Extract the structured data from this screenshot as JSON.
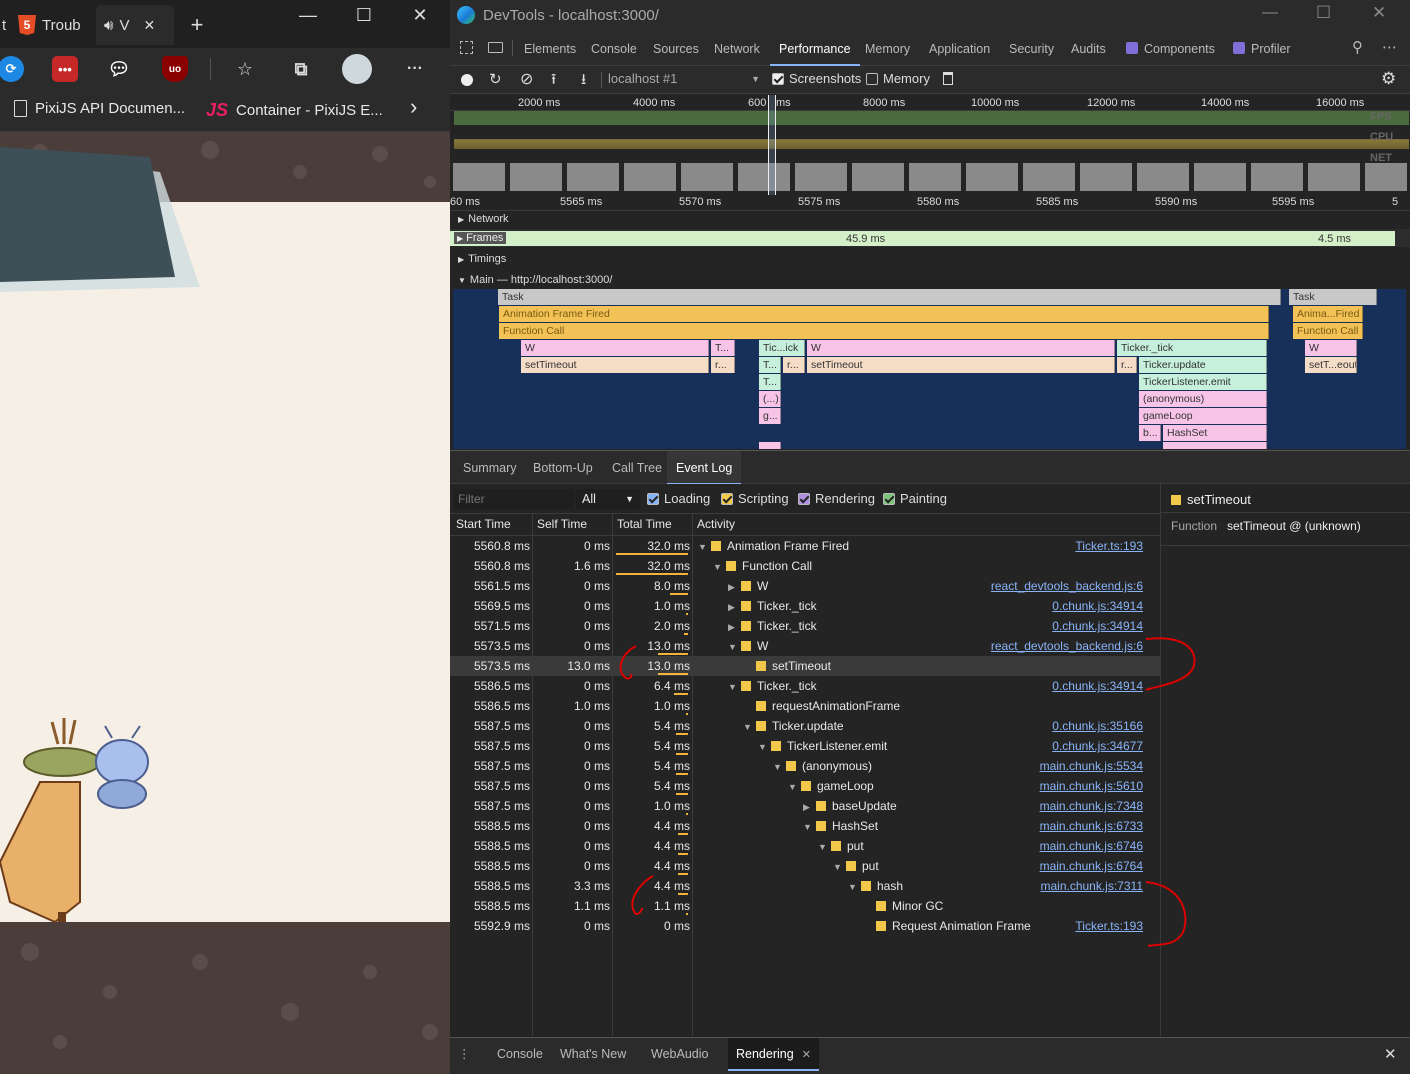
{
  "browser": {
    "tabs": [
      {
        "label": "t"
      },
      {
        "label": "Troub"
      },
      {
        "label": "V"
      }
    ],
    "new_tab": "+",
    "window_controls": {
      "minimize": "—",
      "maximize": "☐",
      "close": "✕"
    },
    "more_label": "···",
    "favorites": [
      {
        "label": "PixiJS API Documen..."
      },
      {
        "label": "Container - PixiJS E..."
      }
    ],
    "fav_more": "›"
  },
  "devtools": {
    "title": "DevTools - localhost:3000/",
    "panel_tabs": [
      "Elements",
      "Console",
      "Sources",
      "Network",
      "Performance",
      "Memory",
      "Application",
      "Security",
      "Audits",
      "Components",
      "Profiler"
    ],
    "active_tab": "Performance",
    "toolbar": {
      "target": "localhost #1",
      "screenshots_label": "Screenshots",
      "screenshots_checked": true,
      "memory_label": "Memory",
      "memory_checked": false
    },
    "overview_ticks": [
      "2000 ms",
      "4000 ms",
      "600",
      "ms",
      "8000 ms",
      "10000 ms",
      "12000 ms",
      "14000 ms",
      "16000 ms"
    ],
    "overview_labels": {
      "fps": "FPS",
      "cpu": "CPU",
      "net": "NET"
    },
    "ruler_ticks": [
      "60 ms",
      "5565 ms",
      "5570 ms",
      "5575 ms",
      "5580 ms",
      "5585 ms",
      "5590 ms",
      "5595 ms",
      "5"
    ],
    "tracks": {
      "network": "Network",
      "frames": "Frames",
      "frame_1": "45.9 ms",
      "frame_2": "4.5 ms",
      "timings": "Timings",
      "main": "Main — http://localhost:3000/"
    },
    "flame": {
      "task": "Task",
      "task2": "Task",
      "animation_frame": "Animation Frame Fired",
      "animation_frame2": "Anima...Fired",
      "function_call": "Function Call",
      "function_call2": "Function Call",
      "w1": "W",
      "t1": "T...",
      "tick1": "Tic...ick",
      "w2": "W",
      "ticker_tick": "Ticker._tick",
      "w3": "W",
      "settimeout1": "setTimeout",
      "r1": "r...",
      "t2": "T...",
      "r2": "r...",
      "settimeout2": "setTimeout",
      "r3": "r...",
      "ticker_update": "Ticker.update",
      "settimeout3": "setT...eout",
      "t3": "T...",
      "listener_emit": "TickerListener.emit",
      "paren": "(...)",
      "anonymous": "(anonymous)",
      "g": "g...",
      "gameloop": "gameLoop",
      "b": "b...",
      "hashset": "HashSet"
    },
    "bottom_tabs": [
      "Summary",
      "Bottom-Up",
      "Call Tree",
      "Event Log"
    ],
    "active_bottom_tab": "Event Log",
    "filter": {
      "placeholder": "Filter",
      "select": "All",
      "loading": "Loading",
      "scripting": "Scripting",
      "rendering": "Rendering",
      "painting": "Painting"
    },
    "columns": [
      "Start Time",
      "Self Time",
      "Total Time",
      "Activity"
    ],
    "rows": [
      {
        "start": "5560.8 ms",
        "self": "0 ms",
        "total": "32.0 ms",
        "arrow": "▼",
        "name": "Animation Frame Fired",
        "src": "Ticker.ts:193",
        "bar": 1.0
      },
      {
        "start": "5560.8 ms",
        "self": "1.6 ms",
        "total": "32.0 ms",
        "arrow": "▼",
        "name": "Function Call",
        "src": "",
        "bar": 1.0
      },
      {
        "start": "5561.5 ms",
        "self": "0 ms",
        "total": "8.0 ms",
        "arrow": "▶",
        "name": "W",
        "src": "react_devtools_backend.js:6",
        "bar": 0.25
      },
      {
        "start": "5569.5 ms",
        "self": "0 ms",
        "total": "1.0 ms",
        "arrow": "▶",
        "name": "Ticker._tick",
        "src": "0.chunk.js:34914",
        "bar": 0.03
      },
      {
        "start": "5571.5 ms",
        "self": "0 ms",
        "total": "2.0 ms",
        "arrow": "▶",
        "name": "Ticker._tick",
        "src": "0.chunk.js:34914",
        "bar": 0.06
      },
      {
        "start": "5573.5 ms",
        "self": "0 ms",
        "total": "13.0 ms",
        "arrow": "▼",
        "name": "W",
        "src": "react_devtools_backend.js:6",
        "bar": 0.41
      },
      {
        "start": "5573.5 ms",
        "self": "13.0 ms",
        "total": "13.0 ms",
        "arrow": "",
        "name": "setTimeout",
        "src": "",
        "bar": 0.41
      },
      {
        "start": "5586.5 ms",
        "self": "0 ms",
        "total": "6.4 ms",
        "arrow": "▼",
        "name": "Ticker._tick",
        "src": "0.chunk.js:34914",
        "bar": 0.2
      },
      {
        "start": "5586.5 ms",
        "self": "1.0 ms",
        "total": "1.0 ms",
        "arrow": "",
        "name": "requestAnimationFrame",
        "src": "",
        "bar": 0.03
      },
      {
        "start": "5587.5 ms",
        "self": "0 ms",
        "total": "5.4 ms",
        "arrow": "▼",
        "name": "Ticker.update",
        "src": "0.chunk.js:35166",
        "bar": 0.17
      },
      {
        "start": "5587.5 ms",
        "self": "0 ms",
        "total": "5.4 ms",
        "arrow": "▼",
        "name": "TickerListener.emit",
        "src": "0.chunk.js:34677",
        "bar": 0.17
      },
      {
        "start": "5587.5 ms",
        "self": "0 ms",
        "total": "5.4 ms",
        "arrow": "▼",
        "name": "(anonymous)",
        "src": "main.chunk.js:5534",
        "bar": 0.17
      },
      {
        "start": "5587.5 ms",
        "self": "0 ms",
        "total": "5.4 ms",
        "arrow": "▼",
        "name": "gameLoop",
        "src": "main.chunk.js:5610",
        "bar": 0.17
      },
      {
        "start": "5587.5 ms",
        "self": "0 ms",
        "total": "1.0 ms",
        "arrow": "▶",
        "name": "baseUpdate",
        "src": "main.chunk.js:7348",
        "bar": 0.03
      },
      {
        "start": "5588.5 ms",
        "self": "0 ms",
        "total": "4.4 ms",
        "arrow": "▼",
        "name": "HashSet",
        "src": "main.chunk.js:6733",
        "bar": 0.14
      },
      {
        "start": "5588.5 ms",
        "self": "0 ms",
        "total": "4.4 ms",
        "arrow": "▼",
        "name": "put",
        "src": "main.chunk.js:6746",
        "bar": 0.14
      },
      {
        "start": "5588.5 ms",
        "self": "0 ms",
        "total": "4.4 ms",
        "arrow": "▼",
        "name": "put",
        "src": "main.chunk.js:6764",
        "bar": 0.14
      },
      {
        "start": "5588.5 ms",
        "self": "3.3 ms",
        "total": "4.4 ms",
        "arrow": "▼",
        "name": "hash",
        "src": "main.chunk.js:7311",
        "bar": 0.14
      },
      {
        "start": "5588.5 ms",
        "self": "1.1 ms",
        "total": "1.1 ms",
        "arrow": "",
        "name": "Minor GC",
        "src": "",
        "bar": 0.03
      },
      {
        "start": "5592.9 ms",
        "self": "0 ms",
        "total": "0 ms",
        "arrow": "",
        "name": "Request Animation Frame",
        "src": "Ticker.ts:193",
        "bar": 0
      }
    ],
    "side": {
      "title": "setTimeout",
      "key": "Function",
      "value": "setTimeout @ (unknown)"
    },
    "drawer": {
      "more": "⋮",
      "tabs": [
        "Console",
        "What's New",
        "WebAudio",
        "Rendering"
      ],
      "active": "Rendering",
      "close_x": "✕"
    }
  }
}
